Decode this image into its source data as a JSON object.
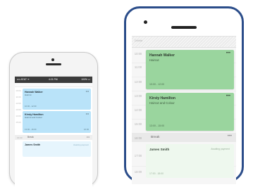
{
  "iphone": {
    "status": {
      "carrier": "•••• AT&T ᯤ",
      "time": "4:21 PM",
      "battery": "100% ▭"
    },
    "slots": [
      "10:00",
      "11:00",
      "12:00",
      "13:00",
      "14:00",
      "15:00",
      "16:00",
      "17:00",
      "18:00"
    ],
    "appointments": [
      {
        "name": "Hannah Walker",
        "detail": "Haircut",
        "time": "10:00 - 12:00"
      },
      {
        "name": "Kirsty Hamilton",
        "detail": "Haircut and Colour",
        "time": "13:00 - 16:00",
        "side": "16:00"
      }
    ],
    "break_label": "Break",
    "break_time": "16:00",
    "pending": {
      "name": "James Smith",
      "status": "Awaiting payment"
    }
  },
  "android": {
    "header_label": "Debbie",
    "slots": [
      "10:00",
      "11:00",
      "12:00",
      "13:00",
      "14:00",
      "15:00",
      "16:00",
      "17:00",
      "18:00"
    ],
    "appointments": [
      {
        "name": "Hannah Walker",
        "detail": "Haircut",
        "time": "10:00 - 12:00"
      },
      {
        "name": "Kirsty Hamilton",
        "detail": "Haircut and Colour",
        "time": "13:00 - 15:00"
      }
    ],
    "break_label": "Break",
    "break_time": "16:00",
    "pending": {
      "name": "James Smith",
      "status": "Awaiting payment",
      "time": "17:00 - 18:00"
    }
  },
  "colors": {
    "iphone_card": "#b9e3f9",
    "iphone_card_light": "#e6f5fd",
    "android_card": "#9ad59e",
    "android_card_light": "#eef8ee",
    "android_frame": "#2b4d8a"
  }
}
